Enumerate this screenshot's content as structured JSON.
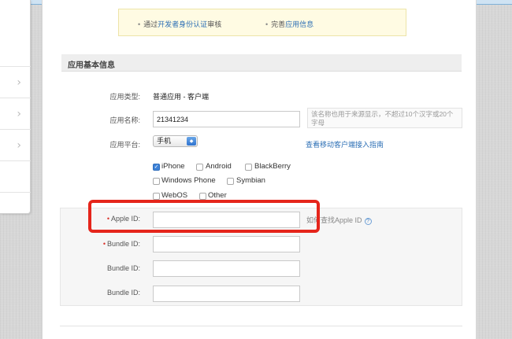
{
  "notice": {
    "item1_prefix": "通过",
    "item1_link": "开发者身份认证",
    "item1_suffix": "审核",
    "item2_prefix": "完善",
    "item2_link": "应用信息"
  },
  "section": {
    "title": "应用基本信息"
  },
  "form": {
    "app_type": {
      "label": "应用类型:",
      "value": "普通应用 - 客户端"
    },
    "app_name": {
      "label": "应用名称:",
      "value": "21341234",
      "hint": "该名称也用于来源显示，不超过10个汉字或20个字母"
    },
    "platform": {
      "label": "应用平台:",
      "selected": "手机",
      "guide_link": "查看移动客户端接入指南"
    },
    "platforms": [
      {
        "label": "iPhone",
        "checked": true
      },
      {
        "label": "Android",
        "checked": false
      },
      {
        "label": "BlackBerry",
        "checked": false
      },
      {
        "label": "Windows Phone",
        "checked": false
      },
      {
        "label": "Symbian",
        "checked": false
      },
      {
        "label": "WebOS",
        "checked": false
      },
      {
        "label": "Other",
        "checked": false
      }
    ],
    "apple_id": {
      "required_mark": "•",
      "label": "Apple ID:",
      "value": "",
      "help_text": "如何查找Apple ID",
      "help_icon": "?"
    },
    "bundle_ids": [
      {
        "required_mark": "•",
        "label": "Bundle ID:",
        "value": ""
      },
      {
        "required_mark": "",
        "label": "Bundle ID:",
        "value": ""
      },
      {
        "required_mark": "",
        "label": "Bundle ID:",
        "value": ""
      }
    ]
  },
  "icons": {
    "chevron": "›",
    "check": "✓",
    "select_arrows": "◆"
  },
  "colors": {
    "link": "#2c6fb5",
    "highlight": "#e5251b",
    "required": "#d9322a",
    "checkbox_checked": "#3d82d8"
  }
}
